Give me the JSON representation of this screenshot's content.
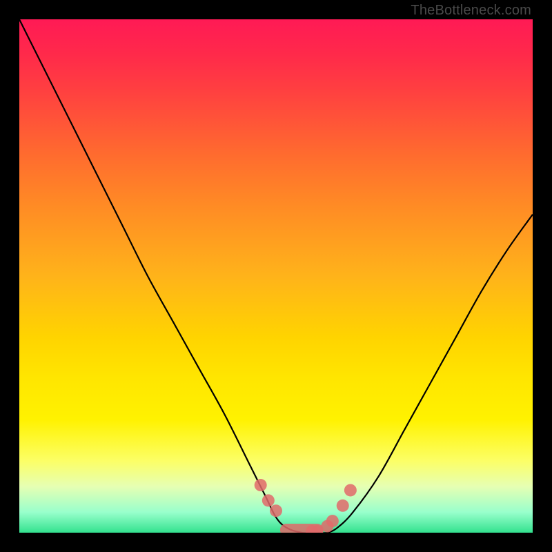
{
  "watermark": "TheBottleneck.com",
  "chart_data": {
    "type": "line",
    "title": "",
    "xlabel": "",
    "ylabel": "",
    "xlim": [
      0,
      100
    ],
    "ylim": [
      0,
      100
    ],
    "grid": false,
    "series": [
      {
        "name": "bottleneck-curve",
        "x": [
          0,
          5,
          10,
          15,
          20,
          25,
          30,
          35,
          40,
          45,
          48,
          50,
          52,
          55,
          58,
          60,
          62,
          65,
          70,
          75,
          80,
          85,
          90,
          95,
          100
        ],
        "y": [
          100,
          90,
          80,
          70,
          60,
          50,
          41,
          32,
          23,
          13,
          7,
          3,
          1,
          0,
          0,
          0,
          1,
          4,
          11,
          20,
          29,
          38,
          47,
          55,
          62
        ]
      }
    ],
    "annotations": {
      "valley_dots_x": [
        47,
        48.5,
        50,
        57,
        58,
        60,
        61,
        63,
        64.5
      ],
      "valley_dots_y": [
        9,
        6,
        4,
        0,
        0,
        1,
        2,
        5,
        8
      ],
      "valley_band_x": [
        52,
        58
      ],
      "valley_band_y": 0
    },
    "background_gradient_stops": [
      {
        "pos": 0,
        "color": "#ff1a55"
      },
      {
        "pos": 50,
        "color": "#ffb31a"
      },
      {
        "pos": 78,
        "color": "#fff200"
      },
      {
        "pos": 100,
        "color": "#33e28f"
      }
    ]
  }
}
